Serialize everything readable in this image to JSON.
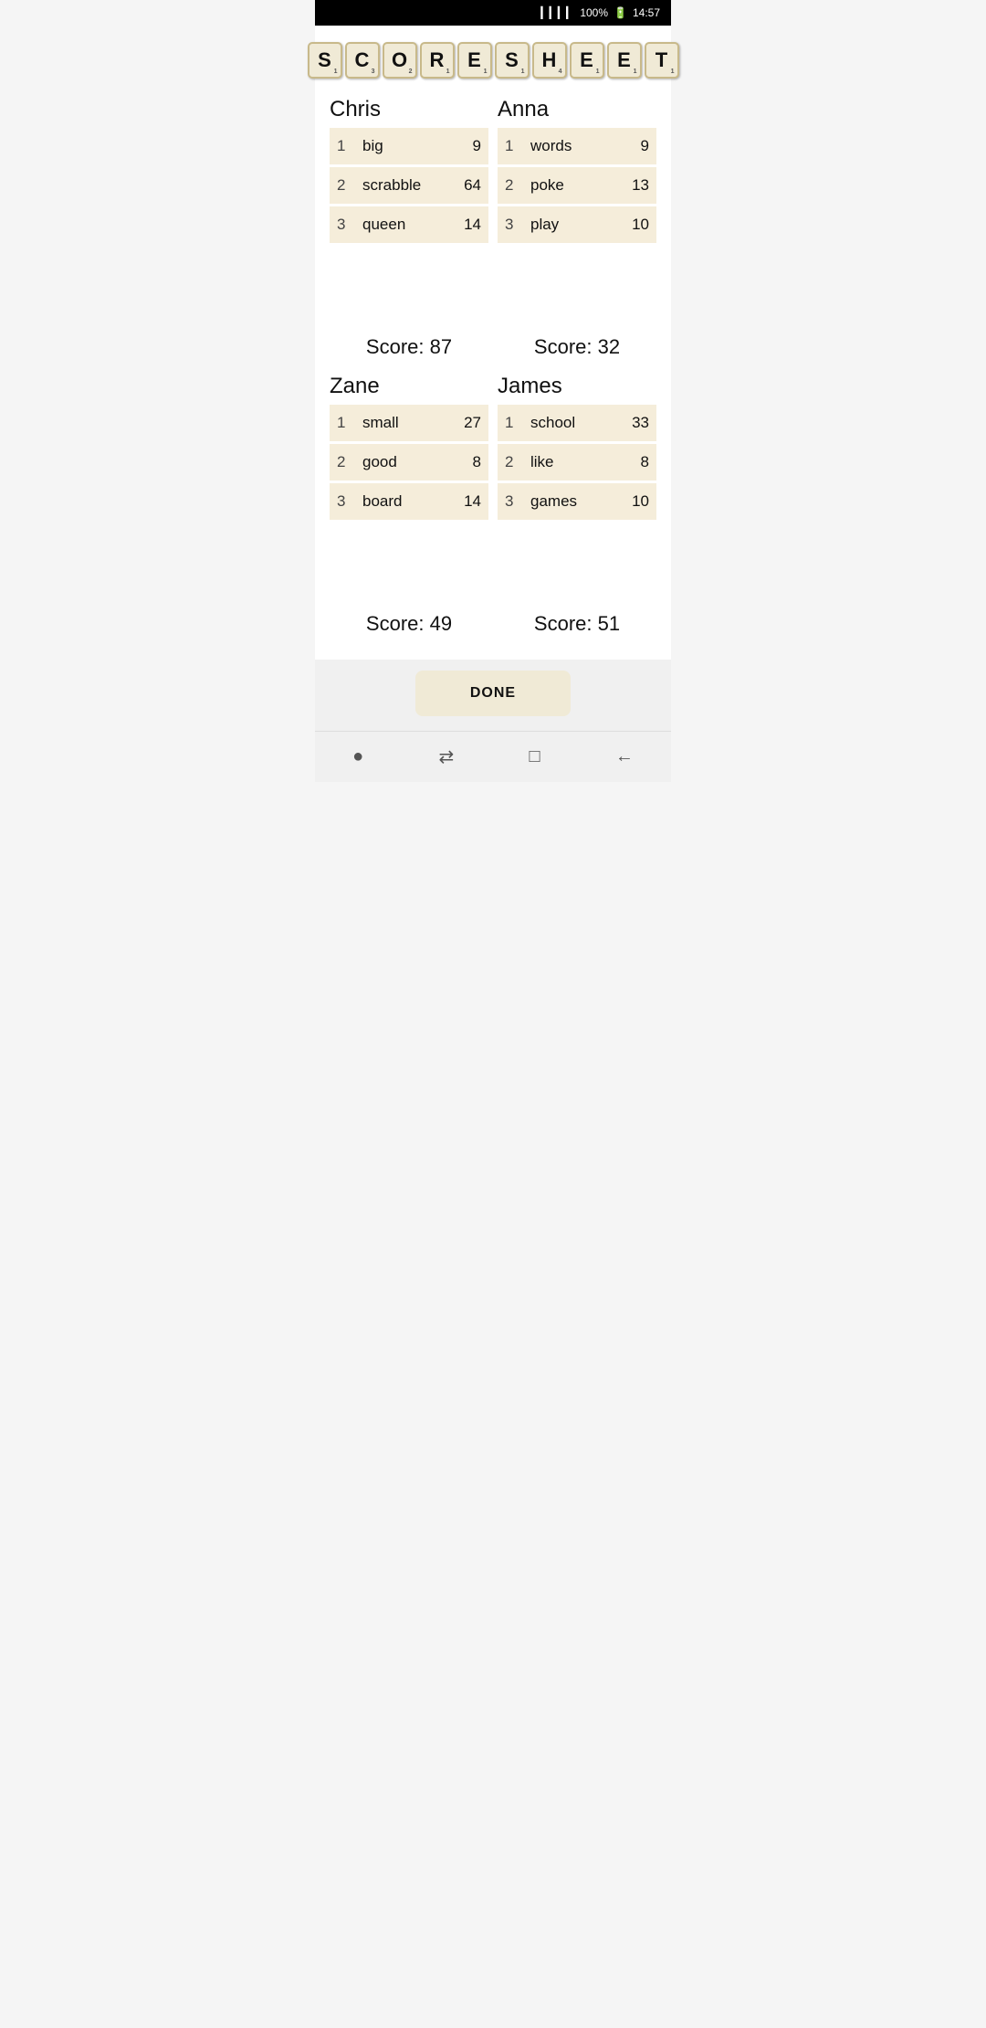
{
  "statusBar": {
    "signal": "▎▎▎▎",
    "battery": "100%",
    "time": "14:57"
  },
  "title": {
    "letters": [
      "S",
      "C",
      "O",
      "R",
      "E",
      "S",
      "H",
      "E",
      "E",
      "T"
    ],
    "letterNums": [
      "1",
      "3",
      "2",
      "1",
      "1",
      "1",
      "4",
      "1",
      "1",
      "1"
    ]
  },
  "players": [
    {
      "name": "Chris",
      "words": [
        {
          "num": 1,
          "word": "big",
          "score": 9
        },
        {
          "num": 2,
          "word": "scrabble",
          "score": 64
        },
        {
          "num": 3,
          "word": "queen",
          "score": 14
        }
      ],
      "total": "Score: 87"
    },
    {
      "name": "Anna",
      "words": [
        {
          "num": 1,
          "word": "words",
          "score": 9
        },
        {
          "num": 2,
          "word": "poke",
          "score": 13
        },
        {
          "num": 3,
          "word": "play",
          "score": 10
        }
      ],
      "total": "Score: 32"
    },
    {
      "name": "Zane",
      "words": [
        {
          "num": 1,
          "word": "small",
          "score": 27
        },
        {
          "num": 2,
          "word": "good",
          "score": 8
        },
        {
          "num": 3,
          "word": "board",
          "score": 14
        }
      ],
      "total": "Score: 49"
    },
    {
      "name": "James",
      "words": [
        {
          "num": 1,
          "word": "school",
          "score": 33
        },
        {
          "num": 2,
          "word": "like",
          "score": 8
        },
        {
          "num": 3,
          "word": "games",
          "score": 10
        }
      ],
      "total": "Score: 51"
    }
  ],
  "doneButton": "DONE",
  "nav": {
    "dot": "●",
    "swap": "⇄",
    "square": "□",
    "back": "←"
  }
}
